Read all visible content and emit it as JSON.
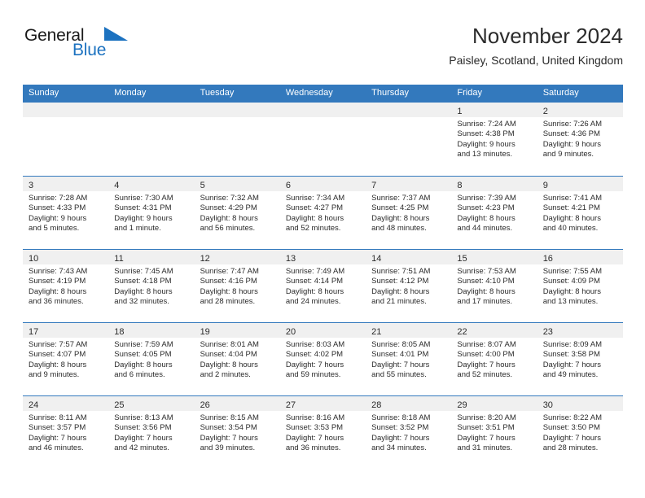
{
  "brand": {
    "name_part1": "General",
    "name_part2": "Blue",
    "logo_icon": "triangle-flag-icon",
    "color_blue": "#1c72c0",
    "color_dark": "#1a1a1a"
  },
  "header": {
    "title": "November 2024",
    "subtitle": "Paisley, Scotland, United Kingdom"
  },
  "theme": {
    "header_row_bg": "#3379bd",
    "daynum_band_bg": "#f0f0f0",
    "row_divider": "#3379bd",
    "text": "#2b2b2b"
  },
  "weekdays": [
    "Sunday",
    "Monday",
    "Tuesday",
    "Wednesday",
    "Thursday",
    "Friday",
    "Saturday"
  ],
  "weeks": [
    [
      {
        "day": "",
        "sunrise": "",
        "sunset": "",
        "daylight_line1": "",
        "daylight_line2": "",
        "empty": true
      },
      {
        "day": "",
        "sunrise": "",
        "sunset": "",
        "daylight_line1": "",
        "daylight_line2": "",
        "empty": true
      },
      {
        "day": "",
        "sunrise": "",
        "sunset": "",
        "daylight_line1": "",
        "daylight_line2": "",
        "empty": true
      },
      {
        "day": "",
        "sunrise": "",
        "sunset": "",
        "daylight_line1": "",
        "daylight_line2": "",
        "empty": true
      },
      {
        "day": "",
        "sunrise": "",
        "sunset": "",
        "daylight_line1": "",
        "daylight_line2": "",
        "empty": true
      },
      {
        "day": "1",
        "sunrise": "Sunrise: 7:24 AM",
        "sunset": "Sunset: 4:38 PM",
        "daylight_line1": "Daylight: 9 hours",
        "daylight_line2": "and 13 minutes."
      },
      {
        "day": "2",
        "sunrise": "Sunrise: 7:26 AM",
        "sunset": "Sunset: 4:36 PM",
        "daylight_line1": "Daylight: 9 hours",
        "daylight_line2": "and 9 minutes."
      }
    ],
    [
      {
        "day": "3",
        "sunrise": "Sunrise: 7:28 AM",
        "sunset": "Sunset: 4:33 PM",
        "daylight_line1": "Daylight: 9 hours",
        "daylight_line2": "and 5 minutes."
      },
      {
        "day": "4",
        "sunrise": "Sunrise: 7:30 AM",
        "sunset": "Sunset: 4:31 PM",
        "daylight_line1": "Daylight: 9 hours",
        "daylight_line2": "and 1 minute."
      },
      {
        "day": "5",
        "sunrise": "Sunrise: 7:32 AM",
        "sunset": "Sunset: 4:29 PM",
        "daylight_line1": "Daylight: 8 hours",
        "daylight_line2": "and 56 minutes."
      },
      {
        "day": "6",
        "sunrise": "Sunrise: 7:34 AM",
        "sunset": "Sunset: 4:27 PM",
        "daylight_line1": "Daylight: 8 hours",
        "daylight_line2": "and 52 minutes."
      },
      {
        "day": "7",
        "sunrise": "Sunrise: 7:37 AM",
        "sunset": "Sunset: 4:25 PM",
        "daylight_line1": "Daylight: 8 hours",
        "daylight_line2": "and 48 minutes."
      },
      {
        "day": "8",
        "sunrise": "Sunrise: 7:39 AM",
        "sunset": "Sunset: 4:23 PM",
        "daylight_line1": "Daylight: 8 hours",
        "daylight_line2": "and 44 minutes."
      },
      {
        "day": "9",
        "sunrise": "Sunrise: 7:41 AM",
        "sunset": "Sunset: 4:21 PM",
        "daylight_line1": "Daylight: 8 hours",
        "daylight_line2": "and 40 minutes."
      }
    ],
    [
      {
        "day": "10",
        "sunrise": "Sunrise: 7:43 AM",
        "sunset": "Sunset: 4:19 PM",
        "daylight_line1": "Daylight: 8 hours",
        "daylight_line2": "and 36 minutes."
      },
      {
        "day": "11",
        "sunrise": "Sunrise: 7:45 AM",
        "sunset": "Sunset: 4:18 PM",
        "daylight_line1": "Daylight: 8 hours",
        "daylight_line2": "and 32 minutes."
      },
      {
        "day": "12",
        "sunrise": "Sunrise: 7:47 AM",
        "sunset": "Sunset: 4:16 PM",
        "daylight_line1": "Daylight: 8 hours",
        "daylight_line2": "and 28 minutes."
      },
      {
        "day": "13",
        "sunrise": "Sunrise: 7:49 AM",
        "sunset": "Sunset: 4:14 PM",
        "daylight_line1": "Daylight: 8 hours",
        "daylight_line2": "and 24 minutes."
      },
      {
        "day": "14",
        "sunrise": "Sunrise: 7:51 AM",
        "sunset": "Sunset: 4:12 PM",
        "daylight_line1": "Daylight: 8 hours",
        "daylight_line2": "and 21 minutes."
      },
      {
        "day": "15",
        "sunrise": "Sunrise: 7:53 AM",
        "sunset": "Sunset: 4:10 PM",
        "daylight_line1": "Daylight: 8 hours",
        "daylight_line2": "and 17 minutes."
      },
      {
        "day": "16",
        "sunrise": "Sunrise: 7:55 AM",
        "sunset": "Sunset: 4:09 PM",
        "daylight_line1": "Daylight: 8 hours",
        "daylight_line2": "and 13 minutes."
      }
    ],
    [
      {
        "day": "17",
        "sunrise": "Sunrise: 7:57 AM",
        "sunset": "Sunset: 4:07 PM",
        "daylight_line1": "Daylight: 8 hours",
        "daylight_line2": "and 9 minutes."
      },
      {
        "day": "18",
        "sunrise": "Sunrise: 7:59 AM",
        "sunset": "Sunset: 4:05 PM",
        "daylight_line1": "Daylight: 8 hours",
        "daylight_line2": "and 6 minutes."
      },
      {
        "day": "19",
        "sunrise": "Sunrise: 8:01 AM",
        "sunset": "Sunset: 4:04 PM",
        "daylight_line1": "Daylight: 8 hours",
        "daylight_line2": "and 2 minutes."
      },
      {
        "day": "20",
        "sunrise": "Sunrise: 8:03 AM",
        "sunset": "Sunset: 4:02 PM",
        "daylight_line1": "Daylight: 7 hours",
        "daylight_line2": "and 59 minutes."
      },
      {
        "day": "21",
        "sunrise": "Sunrise: 8:05 AM",
        "sunset": "Sunset: 4:01 PM",
        "daylight_line1": "Daylight: 7 hours",
        "daylight_line2": "and 55 minutes."
      },
      {
        "day": "22",
        "sunrise": "Sunrise: 8:07 AM",
        "sunset": "Sunset: 4:00 PM",
        "daylight_line1": "Daylight: 7 hours",
        "daylight_line2": "and 52 minutes."
      },
      {
        "day": "23",
        "sunrise": "Sunrise: 8:09 AM",
        "sunset": "Sunset: 3:58 PM",
        "daylight_line1": "Daylight: 7 hours",
        "daylight_line2": "and 49 minutes."
      }
    ],
    [
      {
        "day": "24",
        "sunrise": "Sunrise: 8:11 AM",
        "sunset": "Sunset: 3:57 PM",
        "daylight_line1": "Daylight: 7 hours",
        "daylight_line2": "and 46 minutes."
      },
      {
        "day": "25",
        "sunrise": "Sunrise: 8:13 AM",
        "sunset": "Sunset: 3:56 PM",
        "daylight_line1": "Daylight: 7 hours",
        "daylight_line2": "and 42 minutes."
      },
      {
        "day": "26",
        "sunrise": "Sunrise: 8:15 AM",
        "sunset": "Sunset: 3:54 PM",
        "daylight_line1": "Daylight: 7 hours",
        "daylight_line2": "and 39 minutes."
      },
      {
        "day": "27",
        "sunrise": "Sunrise: 8:16 AM",
        "sunset": "Sunset: 3:53 PM",
        "daylight_line1": "Daylight: 7 hours",
        "daylight_line2": "and 36 minutes."
      },
      {
        "day": "28",
        "sunrise": "Sunrise: 8:18 AM",
        "sunset": "Sunset: 3:52 PM",
        "daylight_line1": "Daylight: 7 hours",
        "daylight_line2": "and 34 minutes."
      },
      {
        "day": "29",
        "sunrise": "Sunrise: 8:20 AM",
        "sunset": "Sunset: 3:51 PM",
        "daylight_line1": "Daylight: 7 hours",
        "daylight_line2": "and 31 minutes."
      },
      {
        "day": "30",
        "sunrise": "Sunrise: 8:22 AM",
        "sunset": "Sunset: 3:50 PM",
        "daylight_line1": "Daylight: 7 hours",
        "daylight_line2": "and 28 minutes."
      }
    ]
  ]
}
